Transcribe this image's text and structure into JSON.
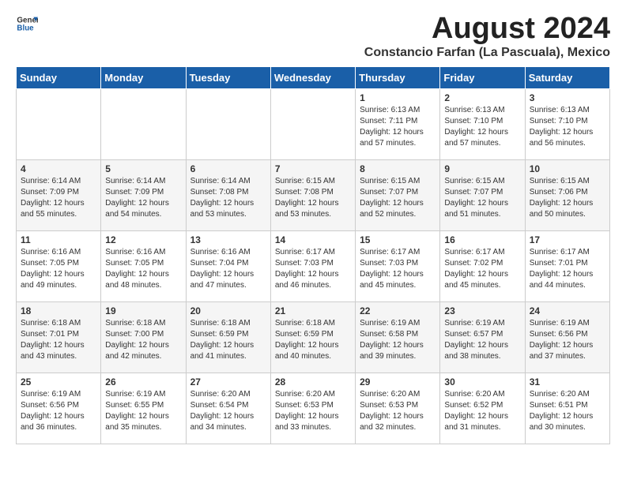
{
  "logo": {
    "general": "General",
    "blue": "Blue"
  },
  "title": "August 2024",
  "subtitle": "Constancio Farfan (La Pascuala), Mexico",
  "days_of_week": [
    "Sunday",
    "Monday",
    "Tuesday",
    "Wednesday",
    "Thursday",
    "Friday",
    "Saturday"
  ],
  "weeks": [
    [
      {
        "day": "",
        "info": ""
      },
      {
        "day": "",
        "info": ""
      },
      {
        "day": "",
        "info": ""
      },
      {
        "day": "",
        "info": ""
      },
      {
        "day": "1",
        "info": "Sunrise: 6:13 AM\nSunset: 7:11 PM\nDaylight: 12 hours and 57 minutes."
      },
      {
        "day": "2",
        "info": "Sunrise: 6:13 AM\nSunset: 7:10 PM\nDaylight: 12 hours and 57 minutes."
      },
      {
        "day": "3",
        "info": "Sunrise: 6:13 AM\nSunset: 7:10 PM\nDaylight: 12 hours and 56 minutes."
      }
    ],
    [
      {
        "day": "4",
        "info": "Sunrise: 6:14 AM\nSunset: 7:09 PM\nDaylight: 12 hours and 55 minutes."
      },
      {
        "day": "5",
        "info": "Sunrise: 6:14 AM\nSunset: 7:09 PM\nDaylight: 12 hours and 54 minutes."
      },
      {
        "day": "6",
        "info": "Sunrise: 6:14 AM\nSunset: 7:08 PM\nDaylight: 12 hours and 53 minutes."
      },
      {
        "day": "7",
        "info": "Sunrise: 6:15 AM\nSunset: 7:08 PM\nDaylight: 12 hours and 53 minutes."
      },
      {
        "day": "8",
        "info": "Sunrise: 6:15 AM\nSunset: 7:07 PM\nDaylight: 12 hours and 52 minutes."
      },
      {
        "day": "9",
        "info": "Sunrise: 6:15 AM\nSunset: 7:07 PM\nDaylight: 12 hours and 51 minutes."
      },
      {
        "day": "10",
        "info": "Sunrise: 6:15 AM\nSunset: 7:06 PM\nDaylight: 12 hours and 50 minutes."
      }
    ],
    [
      {
        "day": "11",
        "info": "Sunrise: 6:16 AM\nSunset: 7:05 PM\nDaylight: 12 hours and 49 minutes."
      },
      {
        "day": "12",
        "info": "Sunrise: 6:16 AM\nSunset: 7:05 PM\nDaylight: 12 hours and 48 minutes."
      },
      {
        "day": "13",
        "info": "Sunrise: 6:16 AM\nSunset: 7:04 PM\nDaylight: 12 hours and 47 minutes."
      },
      {
        "day": "14",
        "info": "Sunrise: 6:17 AM\nSunset: 7:03 PM\nDaylight: 12 hours and 46 minutes."
      },
      {
        "day": "15",
        "info": "Sunrise: 6:17 AM\nSunset: 7:03 PM\nDaylight: 12 hours and 45 minutes."
      },
      {
        "day": "16",
        "info": "Sunrise: 6:17 AM\nSunset: 7:02 PM\nDaylight: 12 hours and 45 minutes."
      },
      {
        "day": "17",
        "info": "Sunrise: 6:17 AM\nSunset: 7:01 PM\nDaylight: 12 hours and 44 minutes."
      }
    ],
    [
      {
        "day": "18",
        "info": "Sunrise: 6:18 AM\nSunset: 7:01 PM\nDaylight: 12 hours and 43 minutes."
      },
      {
        "day": "19",
        "info": "Sunrise: 6:18 AM\nSunset: 7:00 PM\nDaylight: 12 hours and 42 minutes."
      },
      {
        "day": "20",
        "info": "Sunrise: 6:18 AM\nSunset: 6:59 PM\nDaylight: 12 hours and 41 minutes."
      },
      {
        "day": "21",
        "info": "Sunrise: 6:18 AM\nSunset: 6:59 PM\nDaylight: 12 hours and 40 minutes."
      },
      {
        "day": "22",
        "info": "Sunrise: 6:19 AM\nSunset: 6:58 PM\nDaylight: 12 hours and 39 minutes."
      },
      {
        "day": "23",
        "info": "Sunrise: 6:19 AM\nSunset: 6:57 PM\nDaylight: 12 hours and 38 minutes."
      },
      {
        "day": "24",
        "info": "Sunrise: 6:19 AM\nSunset: 6:56 PM\nDaylight: 12 hours and 37 minutes."
      }
    ],
    [
      {
        "day": "25",
        "info": "Sunrise: 6:19 AM\nSunset: 6:56 PM\nDaylight: 12 hours and 36 minutes."
      },
      {
        "day": "26",
        "info": "Sunrise: 6:19 AM\nSunset: 6:55 PM\nDaylight: 12 hours and 35 minutes."
      },
      {
        "day": "27",
        "info": "Sunrise: 6:20 AM\nSunset: 6:54 PM\nDaylight: 12 hours and 34 minutes."
      },
      {
        "day": "28",
        "info": "Sunrise: 6:20 AM\nSunset: 6:53 PM\nDaylight: 12 hours and 33 minutes."
      },
      {
        "day": "29",
        "info": "Sunrise: 6:20 AM\nSunset: 6:53 PM\nDaylight: 12 hours and 32 minutes."
      },
      {
        "day": "30",
        "info": "Sunrise: 6:20 AM\nSunset: 6:52 PM\nDaylight: 12 hours and 31 minutes."
      },
      {
        "day": "31",
        "info": "Sunrise: 6:20 AM\nSunset: 6:51 PM\nDaylight: 12 hours and 30 minutes."
      }
    ]
  ]
}
